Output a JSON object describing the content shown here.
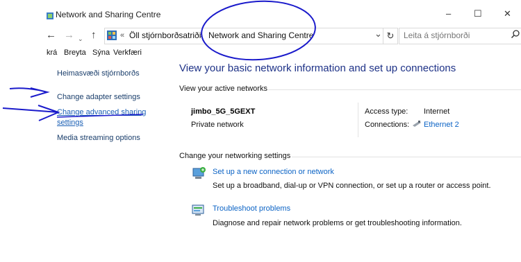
{
  "window": {
    "title": "Network and Sharing Centre",
    "controls": [
      "–",
      "☐",
      "✕"
    ]
  },
  "address_bar": {
    "back_glyph": "←",
    "forward_glyph": "→",
    "up_glyph": "↑",
    "overflow_glyph": "«",
    "crumbs": [
      "Öll stjórnborðsatriði",
      "Network and Sharing Centre"
    ],
    "separator": "›",
    "dropdown_glyph": "⌄",
    "refresh_glyph": "↻",
    "search_placeholder": "Leita á stjórnborði",
    "search_glyph": "⚲"
  },
  "menu": [
    "krá",
    "Breyta",
    "Sýna",
    "Verkfæri"
  ],
  "sidebar": {
    "items": [
      {
        "label": "Heimasvæði stjórnborðs"
      },
      {
        "label": "Change adapter settings"
      },
      {
        "label_line1": "Change advanced sharing",
        "label_line2": "settings"
      },
      {
        "label": "Media streaming options"
      }
    ]
  },
  "main": {
    "title": "View your basic network information and set up connections",
    "active_networks_heading": "View your active networks",
    "network": {
      "name": "jimbo_5G_5GEXT",
      "category": "Private network",
      "access_type_label": "Access type:",
      "access_type_value": "Internet",
      "connections_label": "Connections:",
      "connections_value": "Ethernet 2"
    },
    "change_settings_heading": "Change your networking settings",
    "tasks": [
      {
        "icon": "new-connection-icon",
        "title": "Set up a new connection or network",
        "description": "Set up a broadband, dial-up or VPN connection, or set up a router or access point."
      },
      {
        "icon": "troubleshoot-icon",
        "title": "Troubleshoot problems",
        "description": "Diagnose and repair network problems or get troubleshooting information."
      }
    ]
  },
  "annotation_color": "#1a1acb",
  "colors": {
    "link": "#0b63c5",
    "title": "#1e3287",
    "sidebar_link": "#1a3e6b"
  }
}
